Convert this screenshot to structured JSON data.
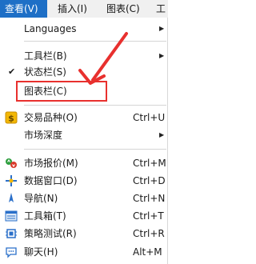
{
  "menubar": {
    "view": "查看(V)",
    "insert": "插入(I)",
    "chart": "图表(C)",
    "tools": "工"
  },
  "menu": {
    "languages": "Languages",
    "toolbar": "工具栏(B)",
    "status_bar": "状态栏(S)",
    "chart_bar": "图表栏(C)",
    "symbols": "交易品种(O)",
    "symbols_sc": "Ctrl+U",
    "depth": "市场深度",
    "market_watch": "市场报价(M)",
    "market_watch_sc": "Ctrl+M",
    "data_window": "数据窗口(D)",
    "data_window_sc": "Ctrl+D",
    "navigator": "导航(N)",
    "navigator_sc": "Ctrl+N",
    "toolbox": "工具箱(T)",
    "toolbox_sc": "Ctrl+T",
    "tester": "策略测试(R)",
    "tester_sc": "Ctrl+R",
    "chat": "聊天(H)",
    "chat_sc": "Alt+M"
  },
  "colors": {
    "accent": "#1e6fc6",
    "callout": "#e8302e"
  },
  "icons": [
    "checkmark-icon",
    "dollar-icon",
    "market-watch-icon",
    "data-window-icon",
    "navigator-icon",
    "toolbox-icon",
    "strategy-tester-icon",
    "chat-icon",
    "submenu-arrow-icon"
  ]
}
